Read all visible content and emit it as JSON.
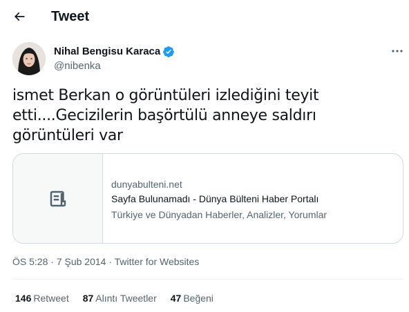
{
  "header": {
    "title": "Tweet",
    "back_icon": "arrow-left-icon"
  },
  "author": {
    "name": "Nihal Bengisu Karaca",
    "handle": "@nibenka",
    "verified": true,
    "verified_color": "#1d9bf0"
  },
  "tweet": {
    "text": "ismet Berkan o görüntüleri izlediğini teyit etti....Gecizilerin başörtülü anneye saldırı görüntüleri var"
  },
  "card": {
    "icon": "document-icon",
    "domain": "dunyabulteni.net",
    "title": "Sayfa Bulunamadı - Dünya Bülteni Haber Portalı",
    "description": "Türkiye ve Dünyadan Haberler, Analizler, Yorumlar"
  },
  "meta": {
    "time": "ÖS 5:28",
    "separator1": " · ",
    "date": "7 Şub 2014",
    "separator2": " · ",
    "source": "Twitter for Websites"
  },
  "stats": [
    {
      "count": "146",
      "label": "Retweet"
    },
    {
      "count": "87",
      "label": "Alıntı Tweetler"
    },
    {
      "count": "47",
      "label": "Beğeni"
    }
  ],
  "colors": {
    "accent": "#1d9bf0",
    "text_primary": "#0f1419",
    "text_secondary": "#536471",
    "border": "#cfd9de"
  }
}
